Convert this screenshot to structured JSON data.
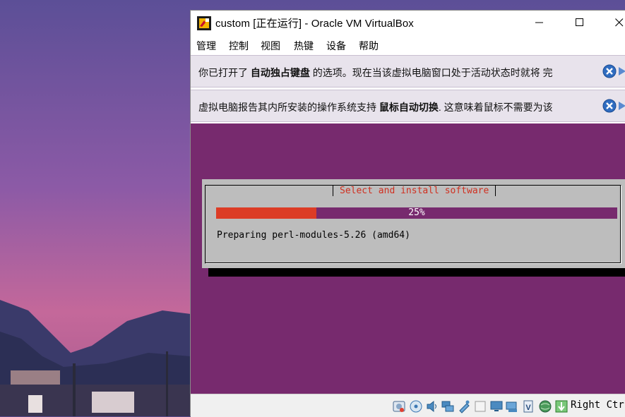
{
  "window": {
    "title": "custom [正在运行] - Oracle VM VirtualBox"
  },
  "menu": [
    "管理",
    "控制",
    "视图",
    "热键",
    "设备",
    "帮助"
  ],
  "notifications": [
    {
      "text_before": "你已打开了 ",
      "bold": "自动独占键盘",
      "text_after": " 的选项。现在当该虚拟电脑窗口处于活动状态时就将 完"
    },
    {
      "text_before": "虚拟电脑报告其内所安装的操作系统支持 ",
      "bold": "鼠标自动切换",
      "text_after": ". 这意味着鼠标不需要为该"
    }
  ],
  "installer": {
    "title": "Select and install software",
    "progress_percent": 25,
    "progress_label": "25%",
    "message": "Preparing perl-modules-5.26 (amd64)"
  },
  "statusbar": {
    "icons": [
      "hard-disk-icon",
      "optical-drive-icon",
      "audio-icon",
      "network-icon",
      "usb-icon",
      "shared-folder-icon",
      "display-icon",
      "video-capture-icon",
      "cpu-v-icon",
      "globe-icon",
      "mouse-integration-icon"
    ],
    "host_key": "Right Ctrl"
  },
  "colors": {
    "vm_background": "#772a6e",
    "progress_fill": "#dc3c26",
    "installer_title": "#d03020",
    "notification_bg": "#e8e3ec"
  }
}
